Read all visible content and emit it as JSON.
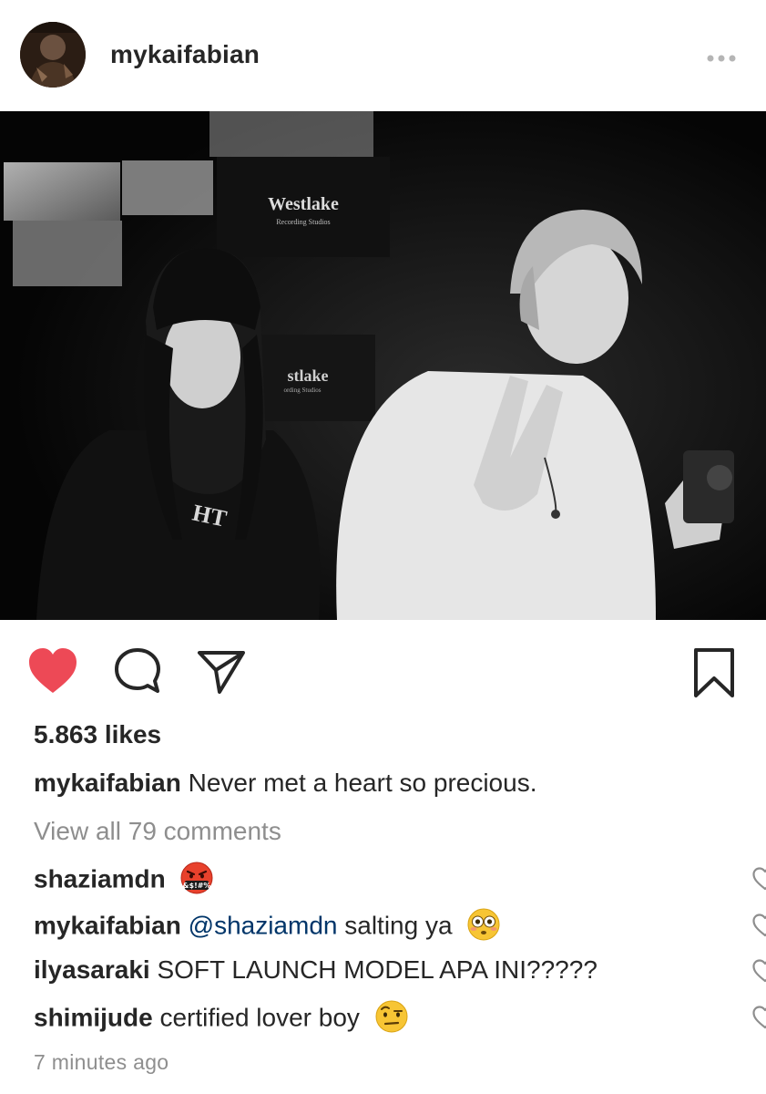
{
  "post": {
    "username": "mykaifabian",
    "photo_signs": [
      "Westlake",
      "Recording Studios",
      "stlake",
      "ording Studios"
    ],
    "likes_text": "5.863 likes",
    "caption": {
      "username": "mykaifabian",
      "text": "Never met a heart so precious."
    },
    "view_all_comments": "View all 79 comments",
    "timestamp": "7 minutes ago"
  },
  "comments": [
    {
      "username": "shaziamdn",
      "text": "",
      "mention": "",
      "emoji": "face-with-symbols-on-mouth-emoji"
    },
    {
      "username": "mykaifabian",
      "mention": "@shaziamdn",
      "text": "salting ya",
      "emoji": "flushed-face-emoji"
    },
    {
      "username": "ilyasaraki",
      "mention": "",
      "text": "SOFT LAUNCH MODEL APA INI?????",
      "emoji": ""
    },
    {
      "username": "shimijude",
      "mention": "",
      "text": "certified lover boy",
      "emoji": "face-with-raised-eyebrow-emoji"
    }
  ],
  "icons": {
    "like": "heart-filled-icon",
    "comment": "comment-bubble-icon",
    "share": "paper-plane-icon",
    "save": "bookmark-icon",
    "more": "more-dots-icon",
    "comment_like": "heart-outline-icon"
  },
  "colors": {
    "like_red": "#ed4956",
    "text": "#262626",
    "muted": "#8e8e8e",
    "mention": "#003569"
  }
}
